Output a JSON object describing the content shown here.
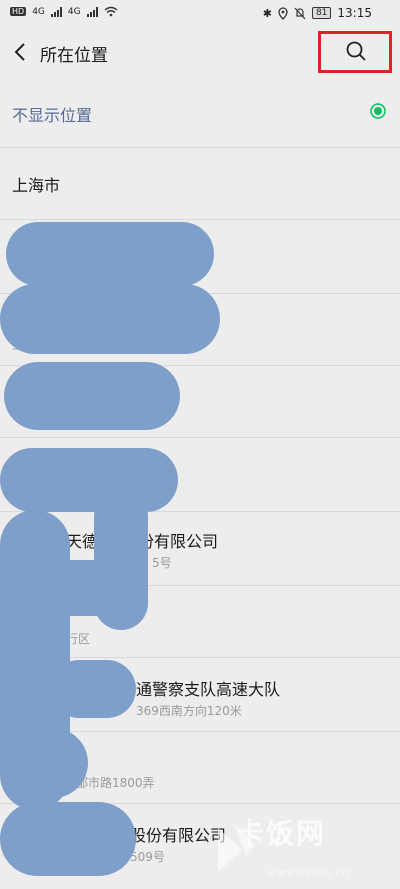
{
  "status_bar": {
    "network_badge": "HD",
    "signal_1": "4G",
    "signal_2": "4G",
    "battery": "81",
    "time": "13:15"
  },
  "header": {
    "title": "所在位置",
    "back_icon": "chevron-left-icon",
    "search_icon": "search-icon",
    "highlight_color": "#d9262b"
  },
  "list": {
    "hide_location": "不显示位置",
    "city": "上海市",
    "items": [
      {
        "title": "",
        "subtitle": ""
      },
      {
        "title": "",
        "subtitle": "上"
      },
      {
        "title": "",
        "subtitle": ""
      },
      {
        "title": "",
        "subtitle": ""
      },
      {
        "title": "天德",
        "title_tail": "份有限公司",
        "subtitle": "5号"
      },
      {
        "title": "",
        "subtitle": "行区"
      },
      {
        "title": "",
        "title_tail": "通警察支队高速大队",
        "subtitle": "369西南方向120米"
      },
      {
        "title": "",
        "subtitle": "都市路1800弄"
      },
      {
        "title": "",
        "title_tail": "股份有限公司",
        "subtitle": "509号"
      }
    ],
    "accent_color": "#576b95",
    "selected_color": "#07c160"
  },
  "watermark": {
    "text": "卡饭网",
    "url": "www.kafan.cn"
  }
}
